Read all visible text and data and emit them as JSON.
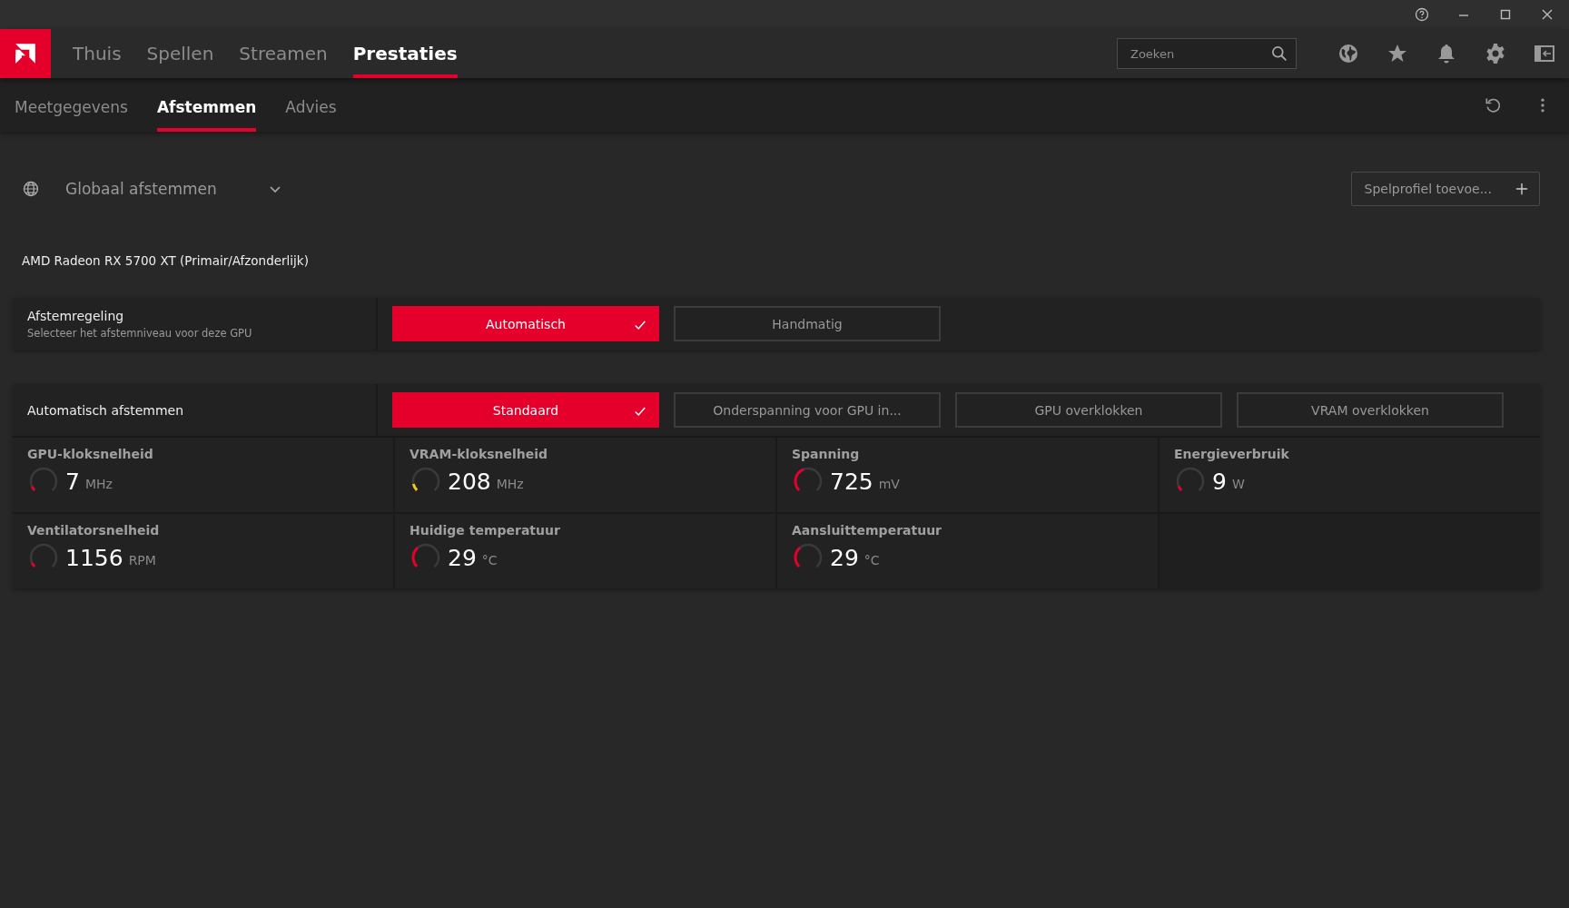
{
  "nav": {
    "tabs": [
      {
        "label": "Thuis",
        "selected": false
      },
      {
        "label": "Spellen",
        "selected": false
      },
      {
        "label": "Streamen",
        "selected": false
      },
      {
        "label": "Prestaties",
        "selected": true
      }
    ],
    "search": {
      "placeholder": "Zoeken"
    }
  },
  "subnav": {
    "tabs": [
      {
        "label": "Meetgegevens",
        "selected": false
      },
      {
        "label": "Afstemmen",
        "selected": true
      },
      {
        "label": "Advies",
        "selected": false
      }
    ]
  },
  "profile": {
    "label": "Globaal afstemmen",
    "add_button": "Spelprofiel toevoe..."
  },
  "gpu_name": "AMD Radeon RX 5700 XT (Primair/Afzonderlijk)",
  "tuning_control": {
    "title": "Afstemregeling",
    "subtitle": "Selecteer het afstemniveau voor deze GPU",
    "options": [
      {
        "label": "Automatisch",
        "selected": true
      },
      {
        "label": "Handmatig",
        "selected": false
      }
    ]
  },
  "auto_tuning": {
    "title": "Automatisch afstemmen",
    "options": [
      {
        "label": "Standaard",
        "selected": true
      },
      {
        "label": "Onderspanning voor GPU in...",
        "selected": false
      },
      {
        "label": "GPU overklokken",
        "selected": false
      },
      {
        "label": "VRAM overklokken",
        "selected": false
      }
    ]
  },
  "metrics": [
    {
      "label": "GPU-kloksnelheid",
      "value": "7",
      "unit": "MHz",
      "level": 0.01,
      "color": "#e4002b"
    },
    {
      "label": "VRAM-kloksnelheid",
      "value": "208",
      "unit": "MHz",
      "level": 0.12,
      "color": "#f5c518"
    },
    {
      "label": "Spanning",
      "value": "725",
      "unit": "mV",
      "level": 0.42,
      "color": "#e4002b"
    },
    {
      "label": "Energieverbruik",
      "value": "9",
      "unit": "W",
      "level": 0.08,
      "color": "#e4002b"
    },
    {
      "label": "Ventilatorsnelheid",
      "value": "1156",
      "unit": "RPM",
      "level": 0.03,
      "color": "#e4002b"
    },
    {
      "label": "Huidige temperatuur",
      "value": "29",
      "unit": "°C",
      "level": 0.35,
      "color": "#e4002b"
    },
    {
      "label": "Aansluittemperatuur",
      "value": "29",
      "unit": "°C",
      "level": 0.35,
      "color": "#e4002b"
    }
  ]
}
